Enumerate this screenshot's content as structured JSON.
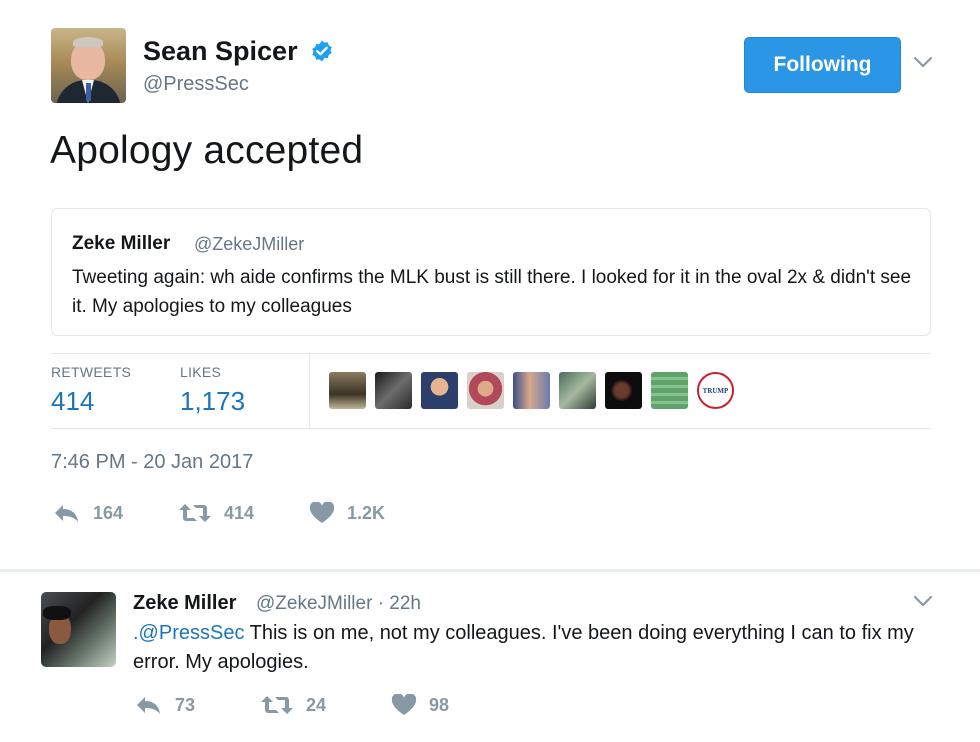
{
  "tweet": {
    "author_name": "Sean Spicer",
    "author_handle": "@PressSec",
    "follow_label": "Following",
    "text": "Apology accepted",
    "quote": {
      "author_name": "Zeke Miller",
      "author_handle": "@ZekeJMiller",
      "text": "Tweeting again: wh aide confirms the MLK bust is still there. I looked for it in the oval 2x & didn't see it. My apologies to my colleagues"
    },
    "stats": {
      "retweets_label": "RETWEETS",
      "retweets_value": "414",
      "likes_label": "LIKES",
      "likes_value": "1,173"
    },
    "likers_badge": "TRUMP",
    "timestamp": "7:46 PM - 20 Jan 2017",
    "actions": {
      "reply": "164",
      "retweet": "414",
      "like": "1.2K"
    }
  },
  "reply": {
    "author_name": "Zeke Miller",
    "meta": "@ZekeJMiller · 22h",
    "mention": ".@PressSec",
    "text": " This is on me, not my colleagues. I've been doing  everything I can to fix my error. My apologies.",
    "actions": {
      "reply": "73",
      "retweet": "24",
      "like": "98"
    }
  },
  "colors": {
    "accent": "#1b75bb",
    "button": "#2b96e6",
    "muted": "#657786",
    "icon": "#8899a6"
  },
  "icons": [
    "verified-badge-icon",
    "chevron-down-icon",
    "reply-icon",
    "retweet-icon",
    "heart-icon"
  ]
}
